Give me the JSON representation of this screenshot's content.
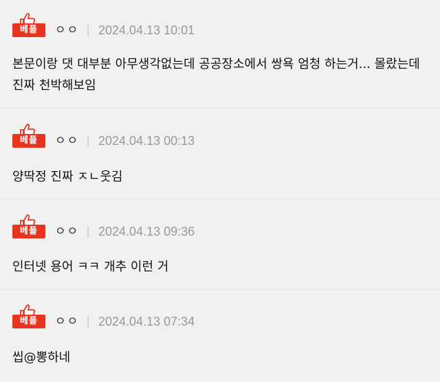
{
  "comments": [
    {
      "badge": "베플",
      "author": "ㅇㅇ",
      "separator": "|",
      "time": "2024.04.13 10:01",
      "text": "본문이랑 댓 대부분 아무생각없는데 공공장소에서 쌍욕 엄청 하는거... 몰랐는데 진짜 천박해보임"
    },
    {
      "badge": "베플",
      "author": "ㅇㅇ",
      "separator": "|",
      "time": "2024.04.13 00:13",
      "text": "양딱정 진짜 ㅈㄴ웃김"
    },
    {
      "badge": "베플",
      "author": "ㅇㅇ",
      "separator": "|",
      "time": "2024.04.13 09:36",
      "text": "인터넷 용어 ㅋㅋ 개추 이런 거"
    },
    {
      "badge": "베플",
      "author": "ㅇㅇ",
      "separator": "|",
      "time": "2024.04.13 07:34",
      "text": "씹@뽕하네"
    }
  ],
  "colors": {
    "badge": "#e8341f",
    "background": "#f1f1f1",
    "time": "#999999"
  },
  "icons": {
    "best": "thumbs-up-icon"
  }
}
